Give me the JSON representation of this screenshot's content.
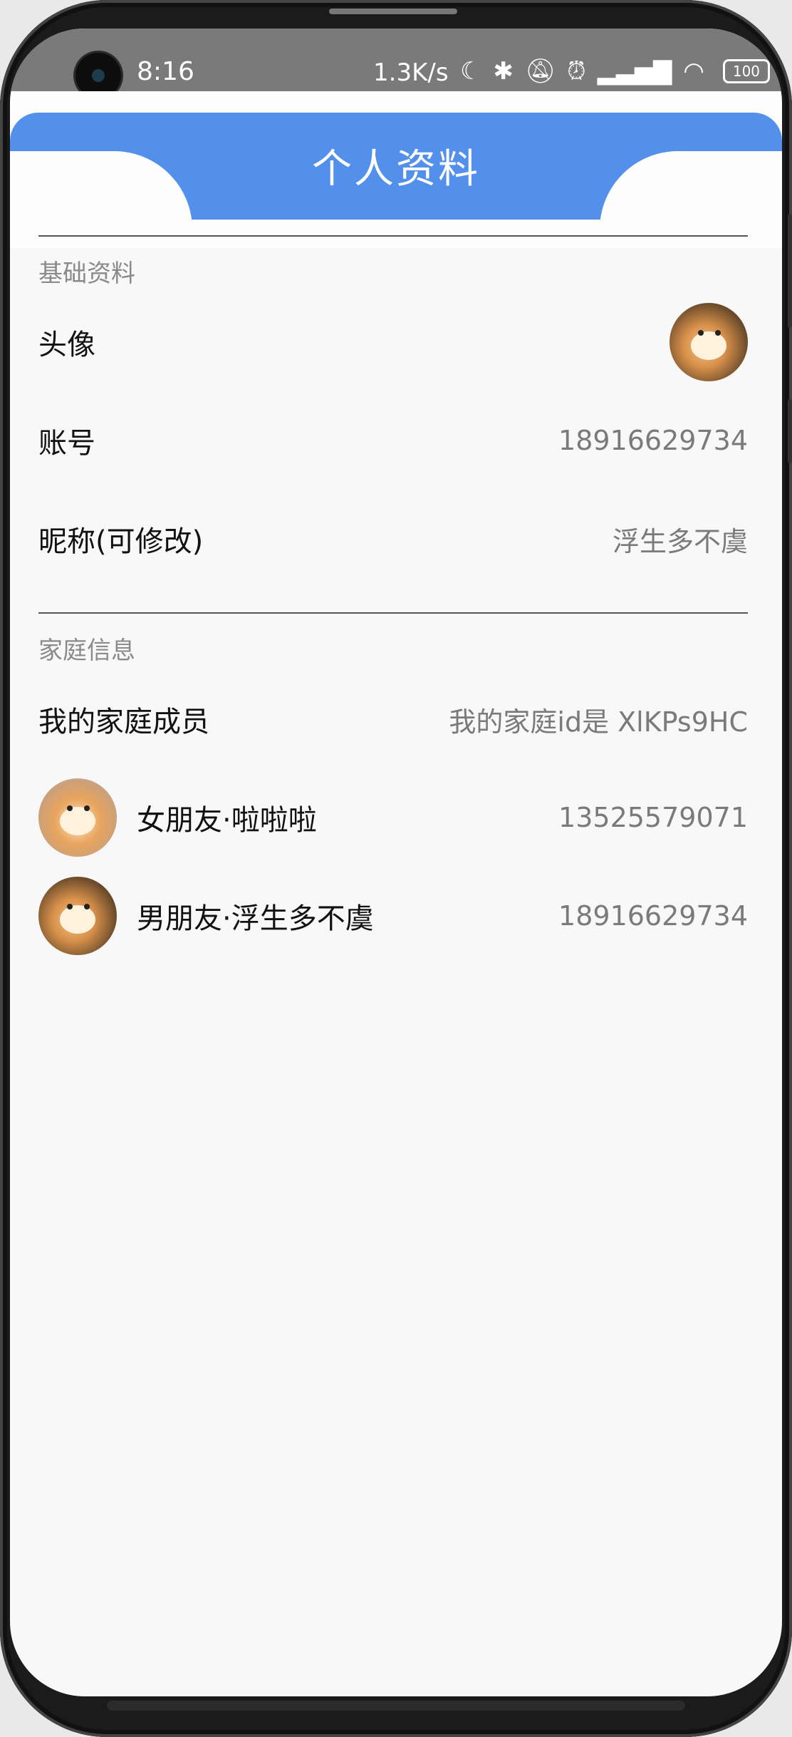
{
  "status_bar": {
    "time": "8:16",
    "network_speed": "1.3K/s",
    "icons": [
      "moon-icon",
      "bluetooth-icon",
      "mute-icon",
      "alarm-icon",
      "signal-icon",
      "wifi-icon"
    ],
    "battery": "100"
  },
  "header": {
    "title": "个人资料",
    "accent_color": "#5390eb"
  },
  "basic_info": {
    "section_label": "基础资料",
    "avatar_label": "头像",
    "account_label": "账号",
    "account_value": "18916629734",
    "nickname_label": "昵称(可修改)",
    "nickname_value": "浮生多不虞"
  },
  "family_info": {
    "section_label": "家庭信息",
    "members_label": "我的家庭成员",
    "family_id_text": "我的家庭id是 XlKPs9HC",
    "members": [
      {
        "name": "女朋友·啦啦啦",
        "phone": "13525579071"
      },
      {
        "name": "男朋友·浮生多不虞",
        "phone": "18916629734"
      }
    ]
  }
}
